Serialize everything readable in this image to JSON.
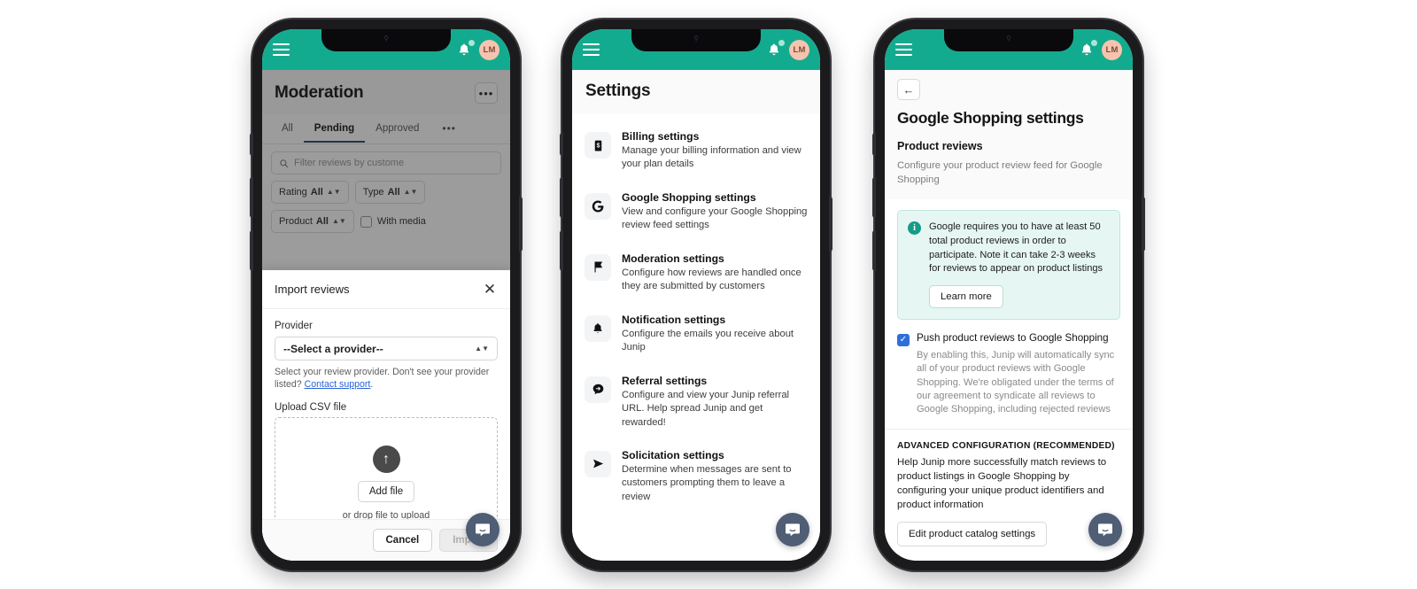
{
  "colors": {
    "teal": "#13ab8f",
    "teal_dark": "#159b86",
    "avatar": "#f6c4ae",
    "blue": "#2f6fdc",
    "intercom": "#4f5d75",
    "tab_active_underline": "#2f4f6f"
  },
  "appbar": {
    "menu_icon": "hamburger-icon",
    "bell_icon": "bell-icon",
    "avatar_initials": "LM"
  },
  "phone1": {
    "page_title": "Moderation",
    "more_label": "•••",
    "tabs": [
      {
        "label": "All",
        "active": false
      },
      {
        "label": "Pending",
        "active": true
      },
      {
        "label": "Approved",
        "active": false
      },
      {
        "label": "•••",
        "active": false
      }
    ],
    "filters": {
      "search_placeholder": "Filter reviews by custome",
      "search_icon": "search-icon",
      "rating": {
        "label": "Rating",
        "value": "All"
      },
      "type": {
        "label": "Type",
        "value": "All"
      },
      "product": {
        "label": "Product",
        "value": "All"
      },
      "with_media_label": "With media",
      "with_media_checked": false
    },
    "sheet": {
      "title": "Import reviews",
      "close_label": "✕",
      "provider_label": "Provider",
      "provider_value": "--Select a provider--",
      "hint_prefix": "Select your review provider. Don't see your provider listed? ",
      "hint_link": "Contact support",
      "hint_suffix": ".",
      "upload_label": "Upload CSV file",
      "upload_icon": "upload-arrow-icon",
      "add_file_label": "Add file",
      "drop_hint": "or drop file to upload",
      "cancel_label": "Cancel",
      "import_label": "Import"
    }
  },
  "phone2": {
    "page_title": "Settings",
    "items": [
      {
        "icon": "billing-icon",
        "name": "Billing settings",
        "desc": "Manage your billing information and view your plan details"
      },
      {
        "icon": "google-g-icon",
        "name": "Google Shopping settings",
        "desc": "View and configure your Google Shopping review feed settings"
      },
      {
        "icon": "flag-icon",
        "name": "Moderation settings",
        "desc": "Configure how reviews are handled once they are submitted by customers"
      },
      {
        "icon": "bell-icon",
        "name": "Notification settings",
        "desc": "Configure the emails you receive about Junip"
      },
      {
        "icon": "referral-chat-arrow-icon",
        "name": "Referral settings",
        "desc": "Configure and view your Junip referral URL. Help spread Junip and get rewarded!"
      },
      {
        "icon": "paper-plane-icon",
        "name": "Solicitation settings",
        "desc": "Determine when messages are sent to customers prompting them to leave a review"
      }
    ]
  },
  "phone3": {
    "back_icon": "arrow-left-icon",
    "page_title": "Google Shopping settings",
    "section_title": "Product reviews",
    "section_desc": "Configure your product review feed for Google Shopping",
    "info": {
      "icon": "info-icon",
      "text": "Google requires you to have at least 50 total product reviews in order to participate. Note it can take 2-3 weeks for reviews to appear on product listings",
      "button_label": "Learn more"
    },
    "push": {
      "checked": true,
      "label": "Push product reviews to Google Shopping",
      "desc": "By enabling this, Junip will automatically sync all of your product reviews with Google Shopping. We're obligated under the terms of our agreement to syndicate all reviews to Google Shopping, including rejected reviews"
    },
    "advanced": {
      "heading": "ADVANCED CONFIGURATION (RECOMMENDED)",
      "desc": "Help Junip more successfully match reviews to product listings in Google Shopping by configuring your unique product identifiers and product information",
      "button_label": "Edit product catalog settings"
    }
  },
  "intercom": {
    "icon": "intercom-chat-icon"
  }
}
